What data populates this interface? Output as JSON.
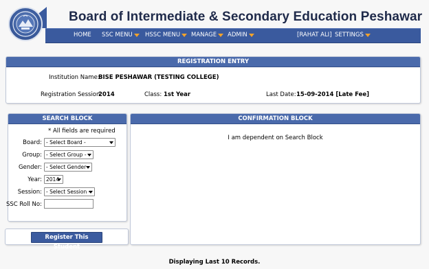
{
  "header": {
    "title": "Board of Intermediate & Secondary Education Peshawar",
    "logo_icon": "bise-peshawar-crest-logo"
  },
  "nav": {
    "home": "HOME",
    "ssc_menu": "SSC MENU",
    "hssc_menu": "HSSC MENU",
    "manage": "MANAGE",
    "admin": "ADMIN",
    "user": "[RAHAT ALI]",
    "settings": "SETTINGS"
  },
  "registration": {
    "heading": "REGISTRATION ENTRY",
    "institution_label": "Institution Name:",
    "institution_value": "BISE PESHAWAR (TESTING COLLEGE)",
    "session_label": "Registration Session:",
    "session_value": "2014",
    "class_label": "Class:",
    "class_value": "1st Year",
    "last_date_label": "Last Date:",
    "last_date_value": "15-09-2014 [Late Fee]"
  },
  "search": {
    "heading": "SEARCH BLOCK",
    "note": "* All fields are required",
    "board_label": "Board:",
    "board_value": "- Select Board -",
    "group_label": "Group:",
    "group_value": "- Select Group -",
    "gender_label": "Gender:",
    "gender_value": "- Select Gender -",
    "year_label": "Year:",
    "year_value": "2014",
    "session_label": "Session:",
    "session_value": "- Select Session -",
    "roll_label": "SSC Roll No:",
    "roll_value": ""
  },
  "confirmation": {
    "heading": "CONFIRMATION BLOCK",
    "message": "I am dependent on Search Block"
  },
  "register_button": "Register This Student",
  "footer": "Displaying Last 10 Records.",
  "colors": {
    "nav_bg": "#3a5a9e",
    "panel_head_bg": "#4a6aab",
    "caret": "#f2a22b",
    "title": "#1f2a4a"
  }
}
